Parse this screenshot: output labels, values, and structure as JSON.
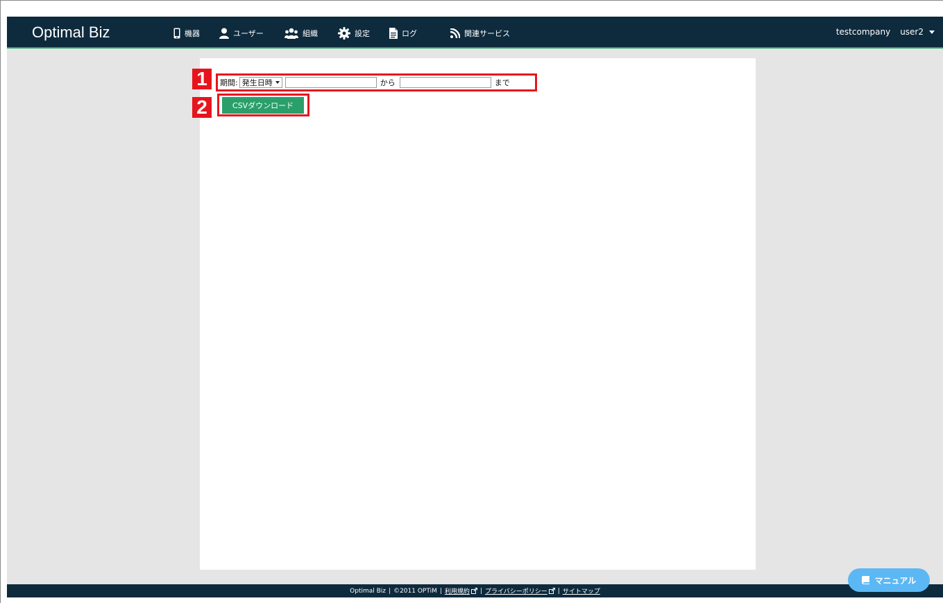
{
  "header": {
    "brand": "Optimal Biz",
    "nav": [
      {
        "label": "機器",
        "icon": "smartphone-icon"
      },
      {
        "label": "ユーザー",
        "icon": "user-icon"
      },
      {
        "label": "組織",
        "icon": "group-icon"
      },
      {
        "label": "設定",
        "icon": "gear-icon"
      },
      {
        "label": "ログ",
        "icon": "document-icon"
      },
      {
        "label": "関連サービス",
        "icon": "rss-icon"
      }
    ],
    "company": "testcompany",
    "user": "user2"
  },
  "filter": {
    "badge": "1",
    "label": "期間:",
    "select_value": "発生日時",
    "from_value": "",
    "from_text": "から",
    "to_value": "",
    "to_text": "まで"
  },
  "download": {
    "badge": "2",
    "label": "CSVダウンロード"
  },
  "footer": {
    "brand": "Optimal Biz",
    "copyright": "©2011 OPTiM",
    "terms": "利用規約",
    "privacy": "プライバシーポリシー",
    "sitemap": "サイトマップ"
  },
  "manual": {
    "label": "マニュアル",
    "icon": "book-icon"
  },
  "colors": {
    "navbar": "#0e2a3d",
    "accent_green": "#27a56a",
    "highlight_red": "#e6151d",
    "manual_blue": "#5bb8f5",
    "page_bg": "#e5e5e5"
  }
}
